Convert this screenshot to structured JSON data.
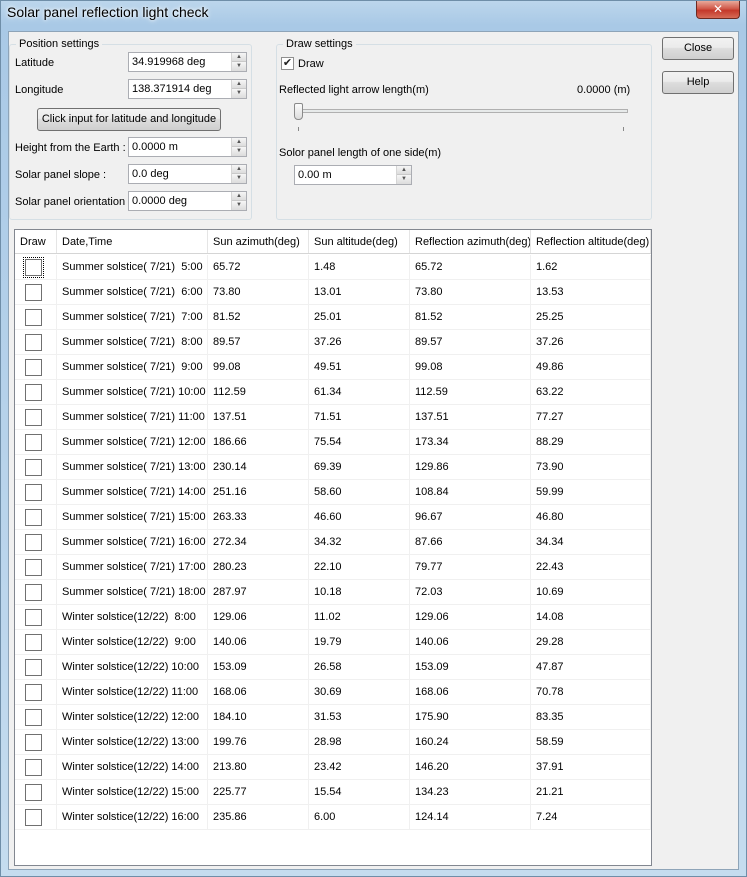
{
  "window": {
    "title": "Solar panel reflection light check",
    "close_glyph": "✕"
  },
  "position": {
    "legend": "Position settings",
    "latitude_label": "Latitude",
    "latitude_value": "34.919968 deg",
    "longitude_label": "Longitude",
    "longitude_value": "138.371914 deg",
    "click_button": "Click input for latitude and longitude",
    "height_label": "Height from the Earth :",
    "height_value": "0.0000 m",
    "slope_label": "Solar panel slope :",
    "slope_value": "0.0 deg",
    "orientation_label": "Solar panel orientation",
    "orientation_value": "0.0000 deg"
  },
  "draw": {
    "legend": "Draw settings",
    "draw_label": "Draw",
    "draw_checked": true,
    "arrow_label": "Reflected light arrow length(m)",
    "arrow_value": "0.0000 (m)",
    "arrow_slider_level": 0,
    "panel_label": "Solor panel length of one side(m)",
    "panel_value": "0.00 m"
  },
  "buttons": {
    "close": "Close",
    "help": "Help"
  },
  "table": {
    "columns": [
      "Draw",
      "Date,Time",
      "Sun azimuth(deg)",
      "Sun altitude(deg)",
      "Reflection azimuth(deg)",
      "Reflection altitude(deg)"
    ],
    "rows": [
      [
        "Summer solstice( 7/21)  5:00",
        "65.72",
        "1.48",
        "65.72",
        "1.62"
      ],
      [
        "Summer solstice( 7/21)  6:00",
        "73.80",
        "13.01",
        "73.80",
        "13.53"
      ],
      [
        "Summer solstice( 7/21)  7:00",
        "81.52",
        "25.01",
        "81.52",
        "25.25"
      ],
      [
        "Summer solstice( 7/21)  8:00",
        "89.57",
        "37.26",
        "89.57",
        "37.26"
      ],
      [
        "Summer solstice( 7/21)  9:00",
        "99.08",
        "49.51",
        "99.08",
        "49.86"
      ],
      [
        "Summer solstice( 7/21) 10:00",
        "112.59",
        "61.34",
        "112.59",
        "63.22"
      ],
      [
        "Summer solstice( 7/21) 11:00",
        "137.51",
        "71.51",
        "137.51",
        "77.27"
      ],
      [
        "Summer solstice( 7/21) 12:00",
        "186.66",
        "75.54",
        "173.34",
        "88.29"
      ],
      [
        "Summer solstice( 7/21) 13:00",
        "230.14",
        "69.39",
        "129.86",
        "73.90"
      ],
      [
        "Summer solstice( 7/21) 14:00",
        "251.16",
        "58.60",
        "108.84",
        "59.99"
      ],
      [
        "Summer solstice( 7/21) 15:00",
        "263.33",
        "46.60",
        "96.67",
        "46.80"
      ],
      [
        "Summer solstice( 7/21) 16:00",
        "272.34",
        "34.32",
        "87.66",
        "34.34"
      ],
      [
        "Summer solstice( 7/21) 17:00",
        "280.23",
        "22.10",
        "79.77",
        "22.43"
      ],
      [
        "Summer solstice( 7/21) 18:00",
        "287.97",
        "10.18",
        "72.03",
        "10.69"
      ],
      [
        "Winter solstice(12/22)  8:00",
        "129.06",
        "11.02",
        "129.06",
        "14.08"
      ],
      [
        "Winter solstice(12/22)  9:00",
        "140.06",
        "19.79",
        "140.06",
        "29.28"
      ],
      [
        "Winter solstice(12/22) 10:00",
        "153.09",
        "26.58",
        "153.09",
        "47.87"
      ],
      [
        "Winter solstice(12/22) 11:00",
        "168.06",
        "30.69",
        "168.06",
        "70.78"
      ],
      [
        "Winter solstice(12/22) 12:00",
        "184.10",
        "31.53",
        "175.90",
        "83.35"
      ],
      [
        "Winter solstice(12/22) 13:00",
        "199.76",
        "28.98",
        "160.24",
        "58.59"
      ],
      [
        "Winter solstice(12/22) 14:00",
        "213.80",
        "23.42",
        "146.20",
        "37.91"
      ],
      [
        "Winter solstice(12/22) 15:00",
        "225.77",
        "15.54",
        "134.23",
        "21.21"
      ],
      [
        "Winter solstice(12/22) 16:00",
        "235.86",
        "6.00",
        "124.14",
        "7.24"
      ]
    ]
  }
}
